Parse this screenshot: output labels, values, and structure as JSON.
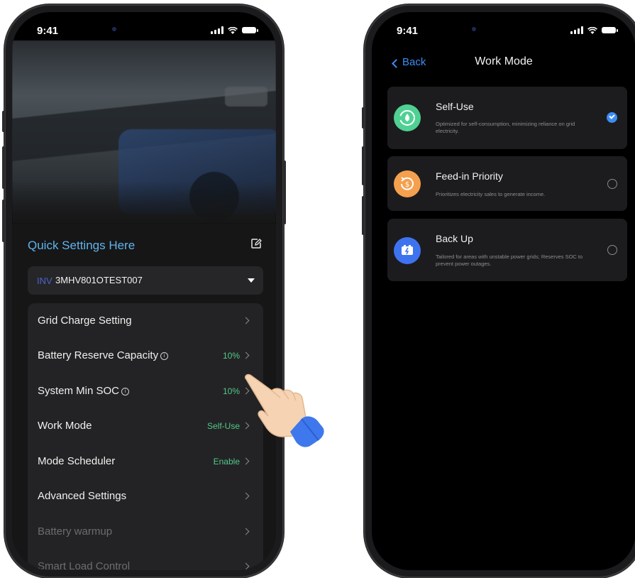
{
  "left_phone": {
    "status": {
      "time": "9:41"
    },
    "quick_settings_title": "Quick Settings Here",
    "inverter": {
      "prefix": "INV",
      "id": "3MHV801OTEST007"
    },
    "settings": [
      {
        "label": "Grid Charge Setting",
        "value": "",
        "info": false,
        "dim": false
      },
      {
        "label": "Battery Reserve Capacity",
        "value": "10%",
        "info": true,
        "dim": false
      },
      {
        "label": "System Min SOC",
        "value": "10%",
        "info": true,
        "dim": false
      },
      {
        "label": "Work Mode",
        "value": "Self-Use",
        "info": false,
        "dim": false
      },
      {
        "label": "Mode Scheduler",
        "value": "Enable",
        "info": false,
        "dim": false
      },
      {
        "label": "Advanced Settings",
        "value": "",
        "info": false,
        "dim": false
      },
      {
        "label": "Battery warmup",
        "value": "",
        "info": false,
        "dim": true
      },
      {
        "label": "Smart Load Control",
        "value": "",
        "info": false,
        "dim": true
      }
    ]
  },
  "right_phone": {
    "status": {
      "time": "9:41"
    },
    "nav": {
      "back_label": "Back",
      "title": "Work Mode"
    },
    "modes": [
      {
        "title": "Self-Use",
        "description": "Optimized for self-consumption, minimizing reliance on grid electricity.",
        "selected": true,
        "icon": "leaf-cycle-icon",
        "color": "#4fd194"
      },
      {
        "title": "Feed-in Priority",
        "description": "Prioritizes electricity sales to generate income.",
        "selected": false,
        "icon": "dollar-cycle-icon",
        "color": "#f4a04f"
      },
      {
        "title": "Back Up",
        "description": "Tailored for areas with unstable power grids; Reserves SOC to prevent power outages.",
        "selected": false,
        "icon": "battery-plug-icon",
        "color": "#3e73f0"
      }
    ]
  },
  "colors": {
    "accent": "#3d8cf5",
    "quick_title": "#5fb4ee",
    "value_green": "#52c98b"
  }
}
